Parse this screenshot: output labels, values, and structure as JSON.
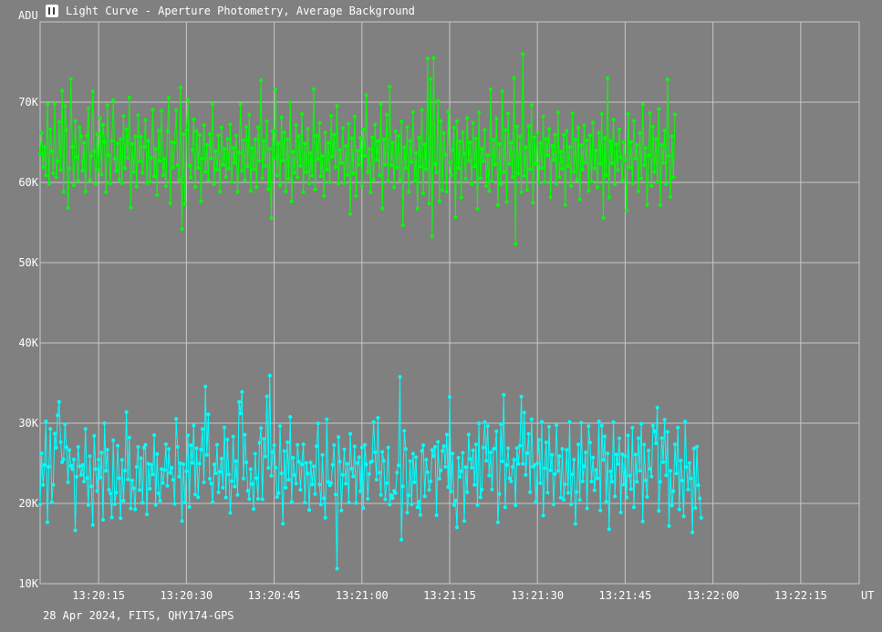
{
  "window": {
    "title": "Light Curve - Aperture Photometry, Average Background",
    "footer": "28 Apr 2024, FITS, QHY174-GPS",
    "icon": "light-curve-app-icon"
  },
  "colors": {
    "background": "#808080",
    "grid": "#c8c8c8",
    "series_green": "#00ff00",
    "series_cyan": "#00ffff"
  },
  "chart_data": {
    "type": "line",
    "xlabel": "UT",
    "ylabel": "ADU",
    "xlim": [
      "13:20:05",
      "13:22:25"
    ],
    "ylim": [
      10000,
      80000
    ],
    "x_ticks": [
      "13:20:15",
      "13:20:30",
      "13:20:45",
      "13:21:00",
      "13:21:15",
      "13:21:30",
      "13:21:45",
      "13:22:00",
      "13:22:15"
    ],
    "y_ticks": [
      "10K",
      "20K",
      "30K",
      "40K",
      "50K",
      "60K",
      "70K"
    ],
    "y_tick_values": [
      10000,
      20000,
      30000,
      40000,
      50000,
      60000,
      70000
    ],
    "grid": true,
    "markers": "dots",
    "series": [
      {
        "color": "#00ff00",
        "x_start": "13:20:05",
        "x_step_seconds": 0.25,
        "values": [
          63520,
          66170,
          61890,
          64420,
          60860,
          69740,
          59820,
          66620,
          63880,
          61150,
          69780,
          60660,
          62670,
          67560,
          61560,
          71420,
          58820,
          69520,
          66510,
          56820,
          61720,
          72880,
          64440,
          59650,
          67660,
          63150,
          60230,
          66880,
          65710,
          61470,
          64940,
          58870,
          65810,
          69220,
          60290,
          63290,
          71330,
          63880,
          59780,
          66010,
          61650,
          68010,
          60970,
          67180,
          65090,
          58800,
          69610,
          63380,
          59890,
          65180,
          70240,
          62940,
          61390,
          64880,
          60360,
          65400,
          59920,
          68260,
          61760,
          66620,
          63050,
          70590,
          56870,
          64810,
          61280,
          65750,
          59490,
          68390,
          62620,
          65710,
          61180,
          64430,
          67770,
          59910,
          65210,
          60070,
          63070,
          69070,
          60740,
          64180,
          58440,
          66430,
          62700,
          68910,
          60890,
          62960,
          59530,
          66390,
          70570,
          57400,
          65010,
          61860,
          64930,
          68990,
          62190,
          60330,
          71840,
          54180,
          65990,
          57300,
          66490,
          70310,
          62090,
          60620,
          64050,
          67850,
          59420,
          66380,
          61810,
          65920,
          57630,
          62990,
          67150,
          61270,
          64670,
          60250,
          66050,
          62980,
          69740,
          59770,
          63920,
          61580,
          65860,
          58820,
          66840,
          62180,
          64190,
          60680,
          65430,
          61720,
          67230,
          60050,
          64330,
          62440,
          65850,
          58830,
          63710,
          69720,
          61460,
          65300,
          60320,
          66910,
          62000,
          68460,
          58930,
          64300,
          61630,
          65350,
          59410,
          66870,
          62680,
          72740,
          60500,
          65210,
          62040,
          67630,
          59150,
          64190,
          55550,
          66390,
          63010,
          71590,
          60860,
          64890,
          59610,
          68110,
          62720,
          66220,
          58880,
          65370,
          60470,
          69980,
          57620,
          63820,
          61190,
          67150,
          60640,
          65770,
          62070,
          68530,
          58800,
          64830,
          61270,
          66690,
          59860,
          63660,
          60840,
          71630,
          59110,
          65820,
          62900,
          67410,
          60760,
          63280,
          58300,
          66210,
          61600,
          64930,
          60020,
          68310,
          63200,
          65970,
          61890,
          69530,
          59850,
          64050,
          62440,
          66800,
          59920,
          64530,
          60950,
          67320,
          56050,
          65510,
          61130,
          68230,
          58310,
          63950,
          62170,
          65580,
          59510,
          66630,
          63310,
          70850,
          61280,
          64160,
          58760,
          65600,
          60310,
          67180,
          62820,
          65160,
          60860,
          69750,
          56740,
          65360,
          62200,
          68430,
          60140,
          71920,
          62140,
          64910,
          59380,
          66380,
          61850,
          65790,
          60340,
          67600,
          54650,
          64370,
          61770,
          66860,
          58790,
          65200,
          62540,
          68760,
          60130,
          63680,
          56720,
          65590,
          61950,
          69010,
          58620,
          64770,
          61650,
          75420,
          57340,
          72870,
          53290,
          75510,
          62330,
          61240,
          70160,
          57620,
          67640,
          59010,
          66160,
          63430,
          58830,
          68800,
          62510,
          60890,
          64010,
          66850,
          55680,
          67640,
          61770,
          65080,
          58110,
          66230,
          63540,
          60460,
          68020,
          62700,
          64990,
          59840,
          67410,
          61980,
          65470,
          56710,
          68720,
          60520,
          64170,
          62620,
          66570,
          59550,
          63380,
          58920,
          71610,
          60140,
          65310,
          62250,
          67970,
          57170,
          64790,
          59760,
          71320,
          61310,
          66530,
          57570,
          68580,
          62300,
          64950,
          60660,
          73030,
          52340,
          66950,
          61100,
          65730,
          58800,
          75980,
          60810,
          64410,
          59080,
          67010,
          61610,
          69630,
          57470,
          65620,
          62330,
          66180,
          59980,
          64910,
          61780,
          68210,
          60060,
          65430,
          63390,
          66660,
          58160,
          64550,
          62790,
          65950,
          59790,
          68730,
          60680,
          63840,
          61670,
          65920,
          57200,
          66390,
          62020,
          64420,
          59560,
          68610,
          61320,
          65330,
          60290,
          66830,
          57890,
          64650,
          61590,
          67100,
          62470,
          65260,
          58960,
          65860,
          60130,
          67450,
          61750,
          63980,
          59370,
          66210,
          62290,
          68520,
          55570,
          65540,
          60870,
          72970,
          58130,
          65170,
          62390,
          67800,
          59750,
          64760,
          61520,
          66610,
          63130,
          60230,
          65020,
          62770,
          56520,
          68530,
          61890,
          65040,
          59880,
          67710,
          62990,
          64690,
          58900,
          66180,
          60500,
          69710,
          62140,
          64300,
          57210,
          63350,
          68640,
          59570,
          66940,
          61280,
          65410,
          60040,
          69140,
          57170,
          64670,
          62430,
          66490,
          59760,
          72840,
          63280,
          58180,
          65760,
          60660,
          68480
        ]
      },
      {
        "color": "#00ffff",
        "x_start": "13:20:05",
        "x_step_seconds": 0.25,
        "values": [
          19870,
          26230,
          22300,
          24780,
          30230,
          17660,
          24580,
          29290,
          20160,
          22320,
          28700,
          26930,
          30990,
          32660,
          27650,
          25120,
          25490,
          29860,
          27000,
          22640,
          26650,
          24670,
          24260,
          25480,
          16650,
          23330,
          27050,
          24610,
          23550,
          24780,
          22730,
          29300,
          23150,
          19780,
          25890,
          22130,
          17320,
          28420,
          24290,
          21530,
          25470,
          23240,
          26320,
          17960,
          30000,
          24070,
          26690,
          21690,
          21230,
          18250,
          27880,
          19890,
          21350,
          27190,
          23160,
          18160,
          25420,
          20340,
          24090,
          31370,
          23000,
          28200,
          19380,
          22880,
          21870,
          19260,
          24540,
          27050,
          21670,
          25640,
          20090,
          26940,
          27290,
          18640,
          24960,
          21830,
          24820,
          23600,
          28520,
          19820,
          26150,
          21250,
          20340,
          24290,
          22530,
          24160,
          27370,
          22190,
          26800,
          23810,
          24430,
          22940,
          19940,
          30530,
          27050,
          23340,
          25010,
          17810,
          24870,
          20110,
          24010,
          28480,
          19540,
          27260,
          25040,
          29720,
          21110,
          26880,
          20770,
          24960,
          26720,
          29260,
          22620,
          34570,
          26050,
          31100,
          23070,
          22490,
          20150,
          24880,
          23760,
          27320,
          21380,
          23940,
          25590,
          21960,
          29470,
          20730,
          27950,
          23610,
          18820,
          22770,
          28340,
          22100,
          25270,
          21070,
          32660,
          31210,
          33900,
          23090,
          28570,
          25110,
          21580,
          20550,
          24270,
          22420,
          19310,
          26190,
          23150,
          20570,
          27540,
          29390,
          20520,
          28040,
          25850,
          33340,
          24420,
          35920,
          23430,
          26420,
          27260,
          24470,
          20790,
          21290,
          29640,
          23750,
          17480,
          26520,
          21970,
          27630,
          22940,
          30780,
          20190,
          25680,
          23530,
          22470,
          27310,
          25180,
          21690,
          24850,
          27350,
          20100,
          25030,
          23720,
          19180,
          25100,
          22350,
          24630,
          21170,
          27130,
          29970,
          22360,
          19870,
          26060,
          20640,
          18200,
          30490,
          22700,
          22240,
          22530,
          24800,
          27270,
          21100,
          11870,
          28280,
          25210,
          19130,
          23570,
          26740,
          22450,
          24940,
          20100,
          28660,
          24330,
          23360,
          27100,
          20040,
          25030,
          25760,
          21520,
          26980,
          19420,
          27300,
          24880,
          20570,
          23660,
          25120,
          25260,
          30140,
          26380,
          22960,
          30670,
          23840,
          21050,
          26420,
          25310,
          20500,
          22530,
          26980,
          19860,
          21020,
          20670,
          21570,
          21300,
          23840,
          24740,
          35760,
          15490,
          22120,
          29050,
          26790,
          18850,
          21010,
          25270,
          19880,
          26190,
          22650,
          25770,
          19510,
          20190,
          18570,
          26540,
          27260,
          20880,
          25460,
          23870,
          21680,
          22760,
          26660,
          25870,
          27040,
          18530,
          27680,
          23080,
          24110,
          26530,
          27150,
          24540,
          28580,
          22040,
          33250,
          21490,
          26200,
          19810,
          20350,
          17020,
          25690,
          23300,
          24020,
          26310,
          17820,
          24530,
          21410,
          28580,
          25520,
          24460,
          26610,
          22320,
          27350,
          19790,
          29980,
          20760,
          21720,
          26960,
          30140,
          25320,
          29650,
          23480,
          26360,
          21750,
          26800,
          26830,
          28990,
          17640,
          21180,
          29890,
          25240,
          33530,
          19520,
          24780,
          26870,
          23140,
          22740,
          24540,
          25450,
          19760,
          26890,
          24910,
          27190,
          33310,
          24930,
          31320,
          23540,
          26250,
          28670,
          21390,
          30480,
          24580,
          24770,
          20220,
          25000,
          27910,
          22530,
          30170,
          18500,
          24390,
          27600,
          21350,
          29560,
          24130,
          26060,
          19880,
          23660,
          29760,
          24040,
          25900,
          20730,
          26800,
          20460,
          22390,
          26680,
          21320,
          30150,
          19880,
          23610,
          25450,
          17460,
          21420,
          27360,
          20420,
          30060,
          22760,
          24610,
          26360,
          19380,
          29620,
          27570,
          22730,
          25730,
          21640,
          24170,
          23130,
          30220,
          19120,
          29690,
          25420,
          28350,
          20190,
          26230,
          16800,
          24000,
          22700,
          30110,
          20880,
          26090,
          24910,
          28110,
          18860,
          26120,
          22340,
          25900,
          20750,
          28470,
          23450,
          21780,
          29430,
          19520,
          26090,
          22700,
          28140,
          24080,
          29930,
          17760,
          27330,
          22860,
          20810,
          26590,
          24320,
          23350,
          29710,
          28990,
          27490,
          31930,
          19080,
          22700,
          28140,
          25130,
          30430,
          23510,
          28920,
          17190,
          24060,
          19730,
          21530,
          27350,
          23740,
          29440,
          19250,
          25340,
          22840,
          18370,
          30200,
          24540,
          21730,
          25020,
          23110,
          16390,
          26840,
          19430,
          27060,
          22260,
          20630,
          18190
        ]
      }
    ]
  }
}
